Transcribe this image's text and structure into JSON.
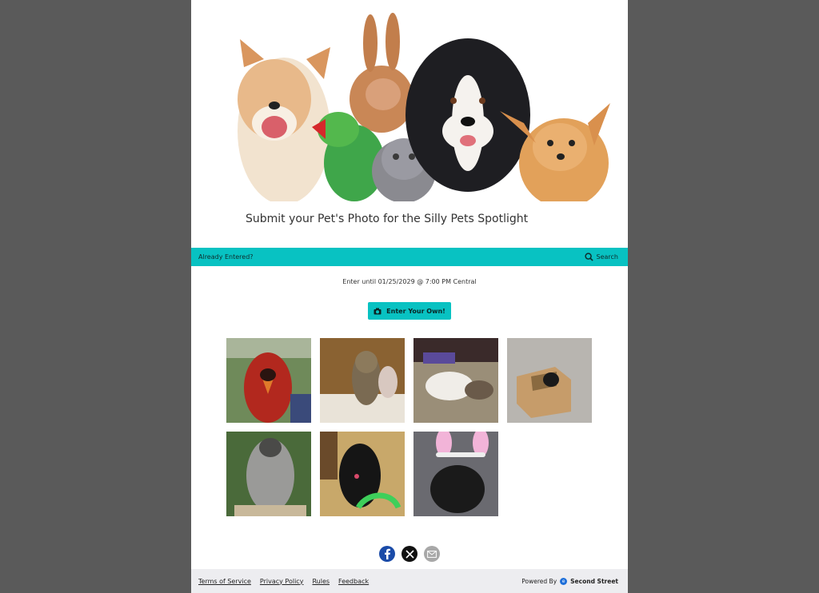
{
  "header": {
    "title": "Submit your Pet's Photo for the Silly Pets Spotlight"
  },
  "bar": {
    "already_entered": "Already Entered?",
    "search_label": "Search",
    "color": "#08c2c2"
  },
  "contest": {
    "enter_until": "Enter until 01/25/2029 @ 7:00 PM Central",
    "enter_button": "Enter Your Own!"
  },
  "gallery": {
    "items": [
      {
        "subject": "cardinal"
      },
      {
        "subject": "cat-in-bag"
      },
      {
        "subject": "cat-on-back"
      },
      {
        "subject": "kitten-in-box"
      },
      {
        "subject": "fluffy-dog"
      },
      {
        "subject": "black-puppy"
      },
      {
        "subject": "dog-bunny-ears"
      }
    ]
  },
  "social": {
    "icons": [
      "facebook-icon",
      "x-icon",
      "email-icon"
    ]
  },
  "footer": {
    "links": [
      "Terms of Service",
      "Privacy Policy",
      "Rules",
      "Feedback"
    ],
    "powered_by": "Powered By",
    "brand": "Second Street",
    "brand_logo_letter": "e"
  }
}
